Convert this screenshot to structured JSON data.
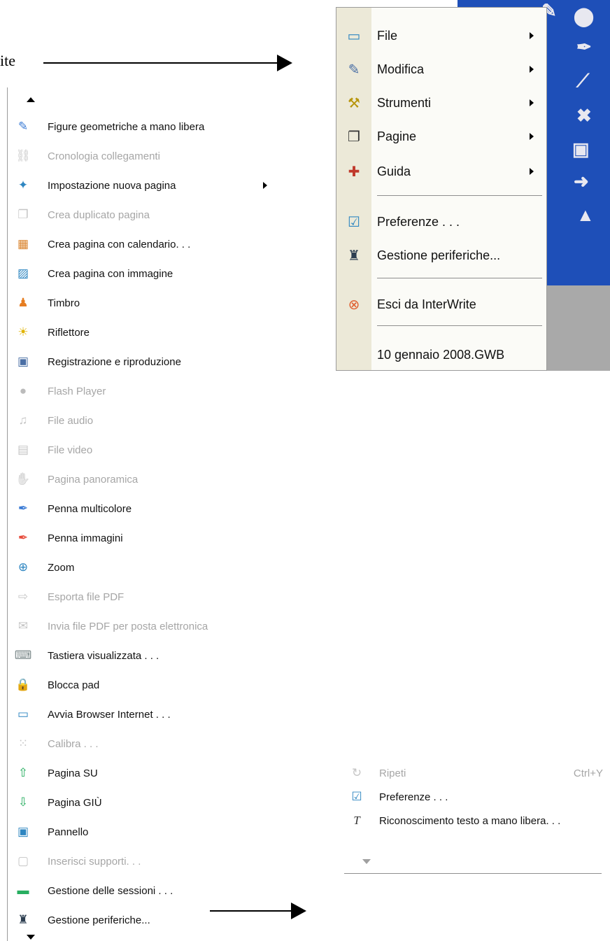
{
  "annotation": {
    "fragment_text": "ite"
  },
  "left_menu": {
    "items": [
      {
        "label": "Figure geometriche a mano libera",
        "icon": "freehand-shapes-icon",
        "glyph": "✎",
        "color": "#3a7bd5",
        "enabled": true,
        "submenu": false
      },
      {
        "label": "Cronologia collegamenti",
        "icon": "link-history-icon",
        "glyph": "⛓",
        "color": "#808080",
        "enabled": false,
        "submenu": false
      },
      {
        "label": "Impostazione nuova pagina",
        "icon": "new-page-settings-icon",
        "glyph": "✦",
        "color": "#2e86c1",
        "enabled": true,
        "submenu": true
      },
      {
        "label": "Crea duplicato pagina",
        "icon": "duplicate-page-icon",
        "glyph": "❐",
        "color": "#808080",
        "enabled": false,
        "submenu": false
      },
      {
        "label": "Crea pagina con calendario. . .",
        "icon": "calendar-page-icon",
        "glyph": "▦",
        "color": "#d9822b",
        "enabled": true,
        "submenu": false
      },
      {
        "label": "Crea pagina con immagine",
        "icon": "image-page-icon",
        "glyph": "▨",
        "color": "#2e86c1",
        "enabled": true,
        "submenu": false
      },
      {
        "label": "Timbro",
        "icon": "stamp-icon",
        "glyph": "♟",
        "color": "#e67e22",
        "enabled": true,
        "submenu": false
      },
      {
        "label": "Riflettore",
        "icon": "spotlight-icon",
        "glyph": "☀",
        "color": "#e0b300",
        "enabled": true,
        "submenu": false
      },
      {
        "label": "Registrazione e riproduzione",
        "icon": "record-playback-icon",
        "glyph": "▣",
        "color": "#4a6fa5",
        "enabled": true,
        "submenu": false
      },
      {
        "label": "Flash Player",
        "icon": "flash-player-icon",
        "glyph": "●",
        "color": "#4a6fa5",
        "enabled": false,
        "submenu": false
      },
      {
        "label": "File audio",
        "icon": "audio-file-icon",
        "glyph": "♫",
        "color": "#808080",
        "enabled": false,
        "submenu": false
      },
      {
        "label": "File video",
        "icon": "video-file-icon",
        "glyph": "▤",
        "color": "#808080",
        "enabled": false,
        "submenu": false
      },
      {
        "label": "Pagina panoramica",
        "icon": "pan-page-icon",
        "glyph": "✋",
        "color": "#808080",
        "enabled": false,
        "submenu": false
      },
      {
        "label": "Penna multicolore",
        "icon": "multicolor-pen-icon",
        "glyph": "✒",
        "color": "#3a7bd5",
        "enabled": true,
        "submenu": false
      },
      {
        "label": "Penna immagini",
        "icon": "image-pen-icon",
        "glyph": "✒",
        "color": "#e74c3c",
        "enabled": true,
        "submenu": false
      },
      {
        "label": "Zoom",
        "icon": "zoom-icon",
        "glyph": "⊕",
        "color": "#2e86c1",
        "enabled": true,
        "submenu": false
      },
      {
        "label": "Esporta file PDF",
        "icon": "export-pdf-icon",
        "glyph": "⇨",
        "color": "#808080",
        "enabled": false,
        "submenu": false
      },
      {
        "label": "Invia file PDF per posta elettronica",
        "icon": "email-pdf-icon",
        "glyph": "✉",
        "color": "#808080",
        "enabled": false,
        "submenu": false
      },
      {
        "label": "Tastiera visualizzata . . .",
        "icon": "onscreen-keyboard-icon",
        "glyph": "⌨",
        "color": "#7f8c8d",
        "enabled": true,
        "submenu": false
      },
      {
        "label": "Blocca pad",
        "icon": "lock-pad-icon",
        "glyph": "🔒",
        "color": "#d4ac0d",
        "enabled": true,
        "submenu": false
      },
      {
        "label": "Avvia Browser Internet . . .",
        "icon": "internet-browser-icon",
        "glyph": "▭",
        "color": "#2e86c1",
        "enabled": true,
        "submenu": false
      },
      {
        "label": "Calibra . . .",
        "icon": "calibrate-icon",
        "glyph": "⁙",
        "color": "#808080",
        "enabled": false,
        "submenu": false
      },
      {
        "label": "Pagina SU",
        "icon": "page-up-icon",
        "glyph": "⇧",
        "color": "#27ae60",
        "enabled": true,
        "submenu": false
      },
      {
        "label": "Pagina GIÙ",
        "icon": "page-down-icon",
        "glyph": "⇩",
        "color": "#27ae60",
        "enabled": true,
        "submenu": false
      },
      {
        "label": "Pannello",
        "icon": "panel-icon",
        "glyph": "▣",
        "color": "#2e86c1",
        "enabled": true,
        "submenu": false
      },
      {
        "label": "Inserisci supporti. . .",
        "icon": "insert-media-icon",
        "glyph": "▢",
        "color": "#808080",
        "enabled": false,
        "submenu": false
      },
      {
        "label": "Gestione delle sessioni . . .",
        "icon": "session-manager-icon",
        "glyph": "▬",
        "color": "#27ae60",
        "enabled": true,
        "submenu": false
      },
      {
        "label": "Gestione periferiche...",
        "icon": "device-manager-icon",
        "glyph": "♜",
        "color": "#2c3e50",
        "enabled": true,
        "submenu": false
      }
    ]
  },
  "top_menu": {
    "items": [
      {
        "label": "File",
        "icon": "file-folder-icon",
        "glyph": "▭",
        "color": "#2e86c1",
        "submenu": true
      },
      {
        "label": "Modifica",
        "icon": "edit-icon",
        "glyph": "✎",
        "color": "#4a6fa5",
        "submenu": true
      },
      {
        "label": "Strumenti",
        "icon": "tools-icon",
        "glyph": "⚒",
        "color": "#b7950b",
        "submenu": true
      },
      {
        "label": "Pagine",
        "icon": "pages-icon",
        "glyph": "❐",
        "color": "#333333",
        "submenu": true
      },
      {
        "label": "Guida",
        "icon": "help-kit-icon",
        "glyph": "✚",
        "color": "#c0392b",
        "submenu": true
      },
      {
        "label": "Preferenze . . .",
        "icon": "preferences-icon",
        "glyph": "☑",
        "color": "#2e86c1",
        "submenu": false
      },
      {
        "label": "Gestione periferiche...",
        "icon": "device-manager-icon",
        "glyph": "♜",
        "color": "#2c3e50",
        "submenu": false
      },
      {
        "label": "Esci da InterWrite",
        "icon": "exit-icon",
        "glyph": "⊗",
        "color": "#e06030",
        "submenu": false
      },
      {
        "label": "10 gennaio 2008.GWB",
        "icon": "",
        "glyph": "",
        "color": "#000000",
        "submenu": false
      }
    ]
  },
  "bottom_menu": {
    "items": [
      {
        "label": "Ripeti",
        "shortcut": "Ctrl+Y",
        "icon": "redo-icon",
        "glyph": "↻",
        "color": "#808080",
        "enabled": false
      },
      {
        "label": "Preferenze . . .",
        "shortcut": "",
        "icon": "preferences-icon",
        "glyph": "☑",
        "color": "#2e86c1",
        "enabled": true
      },
      {
        "label": "Riconoscimento testo a mano libera. . .",
        "shortcut": "",
        "icon": "handwriting-recognition-icon",
        "glyph": "T",
        "color": "#333333",
        "enabled": true
      }
    ]
  }
}
